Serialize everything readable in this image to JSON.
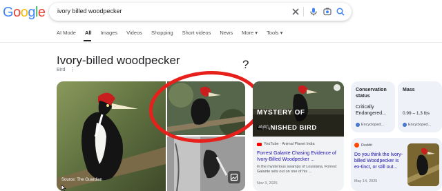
{
  "logo": {
    "letters": [
      "G",
      "o",
      "o",
      "g",
      "l",
      "e"
    ],
    "colors": [
      "#4285F4",
      "#EA4335",
      "#FBBC05",
      "#4285F4",
      "#34A853",
      "#EA4335"
    ]
  },
  "search": {
    "query": "ivory billed woodpecker",
    "icons": [
      "close-icon",
      "mic-icon",
      "lens-icon",
      "search-icon"
    ]
  },
  "tabs": [
    {
      "label": "AI Mode"
    },
    {
      "label": "All",
      "active": true
    },
    {
      "label": "Images"
    },
    {
      "label": "Videos"
    },
    {
      "label": "Shopping"
    },
    {
      "label": "Short videos"
    },
    {
      "label": "News"
    },
    {
      "label": "More ▾"
    },
    {
      "label": "Tools ▾"
    }
  ],
  "entity": {
    "title": "Ivory-billed woodpecker",
    "subtitle": "Bird",
    "more_glyph": "⋮"
  },
  "annotation": {
    "question_mark": "?",
    "circle_color": "#e8201c"
  },
  "images": {
    "main_source": "Source: The Guardian"
  },
  "video": {
    "overlay_line1": "MYSTERY OF",
    "overlay_line2": "VANISHED BIRD",
    "duration": "46:00",
    "source": "YouTube · Animal Planet India",
    "title": "Forrest Galante Chasing Evidence of Ivory-Billed Woodpecker ...",
    "snippet": "In the mysterious swamps of Louisiana, Forrest Galante sets out on one of his ...",
    "date": "Nov 3, 2025"
  },
  "facts": [
    {
      "label": "Conservation status",
      "value": "Critically Endangered...",
      "source": "Encycloped..."
    },
    {
      "label": "Mass",
      "value": "0.99 – 1.3 lbs",
      "source": "Encycloped..."
    }
  ],
  "reddit": {
    "source": "Reddit",
    "title": "Do you think the Ivory-billed Woodpecker is ex-tinct, or still out...",
    "date": "May 14, 2025"
  }
}
